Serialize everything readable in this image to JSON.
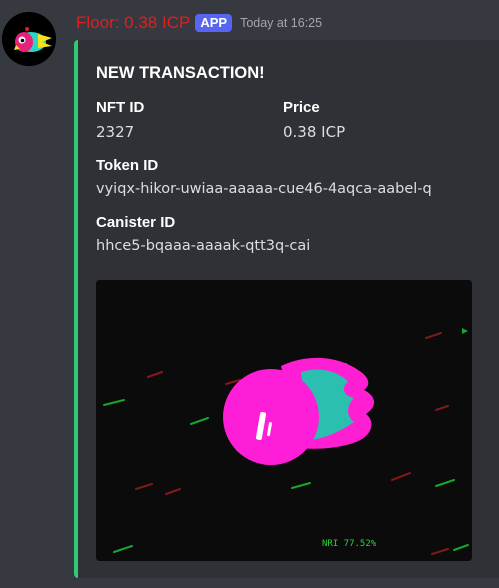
{
  "message": {
    "author": "Floor: 0.38 ICP",
    "bot_tag": "APP",
    "timestamp": "Today at 16:25"
  },
  "embed": {
    "accent_color": "#2ecc71",
    "title": "NEW TRANSACTION!",
    "fields": [
      {
        "name": "NFT ID",
        "value": "2327"
      },
      {
        "name": "Price",
        "value": "0.38 ICP"
      },
      {
        "name": "Token ID",
        "value": "vyiqx-hikor-uwiaa-aaaaa-cue46-4aqca-aabel-q"
      },
      {
        "name": "Canister ID",
        "value": "hhce5-bqaaa-aaaak-qtt3q-cai"
      }
    ],
    "image": {
      "icon": "nft-comet-image",
      "overlay_text": "NRI 77.52%"
    }
  },
  "colors": {
    "username": "#e21e1e",
    "bot_tag": "#5865f2",
    "background": "#36393f",
    "embed_background": "#2f3136"
  }
}
